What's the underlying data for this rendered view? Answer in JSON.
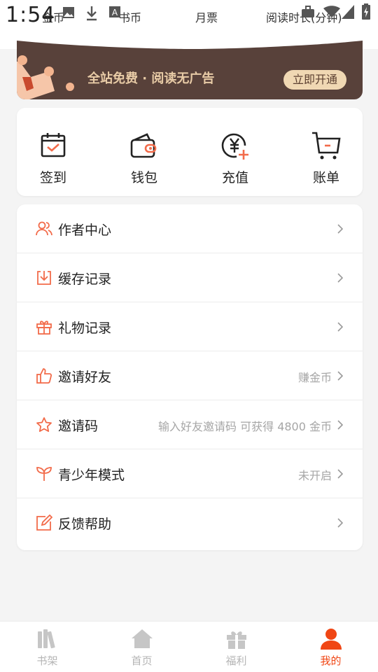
{
  "status_bar": {
    "time": "1:54",
    "labels": [
      "金币",
      "书币",
      "月票",
      "阅读时长(分钟)"
    ]
  },
  "vip_banner": {
    "text": "全站免费 · 阅读无广告",
    "button": "立即开通"
  },
  "quick_actions": [
    {
      "label": "签到",
      "icon": "calendar-check-icon"
    },
    {
      "label": "钱包",
      "icon": "wallet-icon"
    },
    {
      "label": "充值",
      "icon": "yen-plus-icon"
    },
    {
      "label": "账单",
      "icon": "cart-icon"
    }
  ],
  "menu": [
    {
      "label": "作者中心",
      "hint": "",
      "icon": "users-icon"
    },
    {
      "label": "缓存记录",
      "hint": "",
      "icon": "download-box-icon"
    },
    {
      "label": "礼物记录",
      "hint": "",
      "icon": "gift-icon"
    },
    {
      "label": "邀请好友",
      "hint": "赚金币",
      "icon": "thumbs-up-icon"
    },
    {
      "label": "邀请码",
      "hint": "输入好友邀请码 可获得 4800 金币",
      "icon": "star-icon"
    },
    {
      "label": "青少年模式",
      "hint": "未开启",
      "icon": "sprout-icon"
    },
    {
      "label": "反馈帮助",
      "hint": "",
      "icon": "edit-icon"
    }
  ],
  "bottom_nav": [
    {
      "label": "书架",
      "icon": "bookshelf-icon",
      "active": false
    },
    {
      "label": "首页",
      "icon": "home-icon",
      "active": false
    },
    {
      "label": "福利",
      "icon": "gift-box-icon",
      "active": false
    },
    {
      "label": "我的",
      "icon": "user-icon",
      "active": true
    }
  ],
  "colors": {
    "accent": "#f04614",
    "icon_orange": "#f26b4a",
    "vip_bg": "#58413a",
    "vip_text": "#e8cba6",
    "vip_button_bg": "#f0d8b3"
  }
}
